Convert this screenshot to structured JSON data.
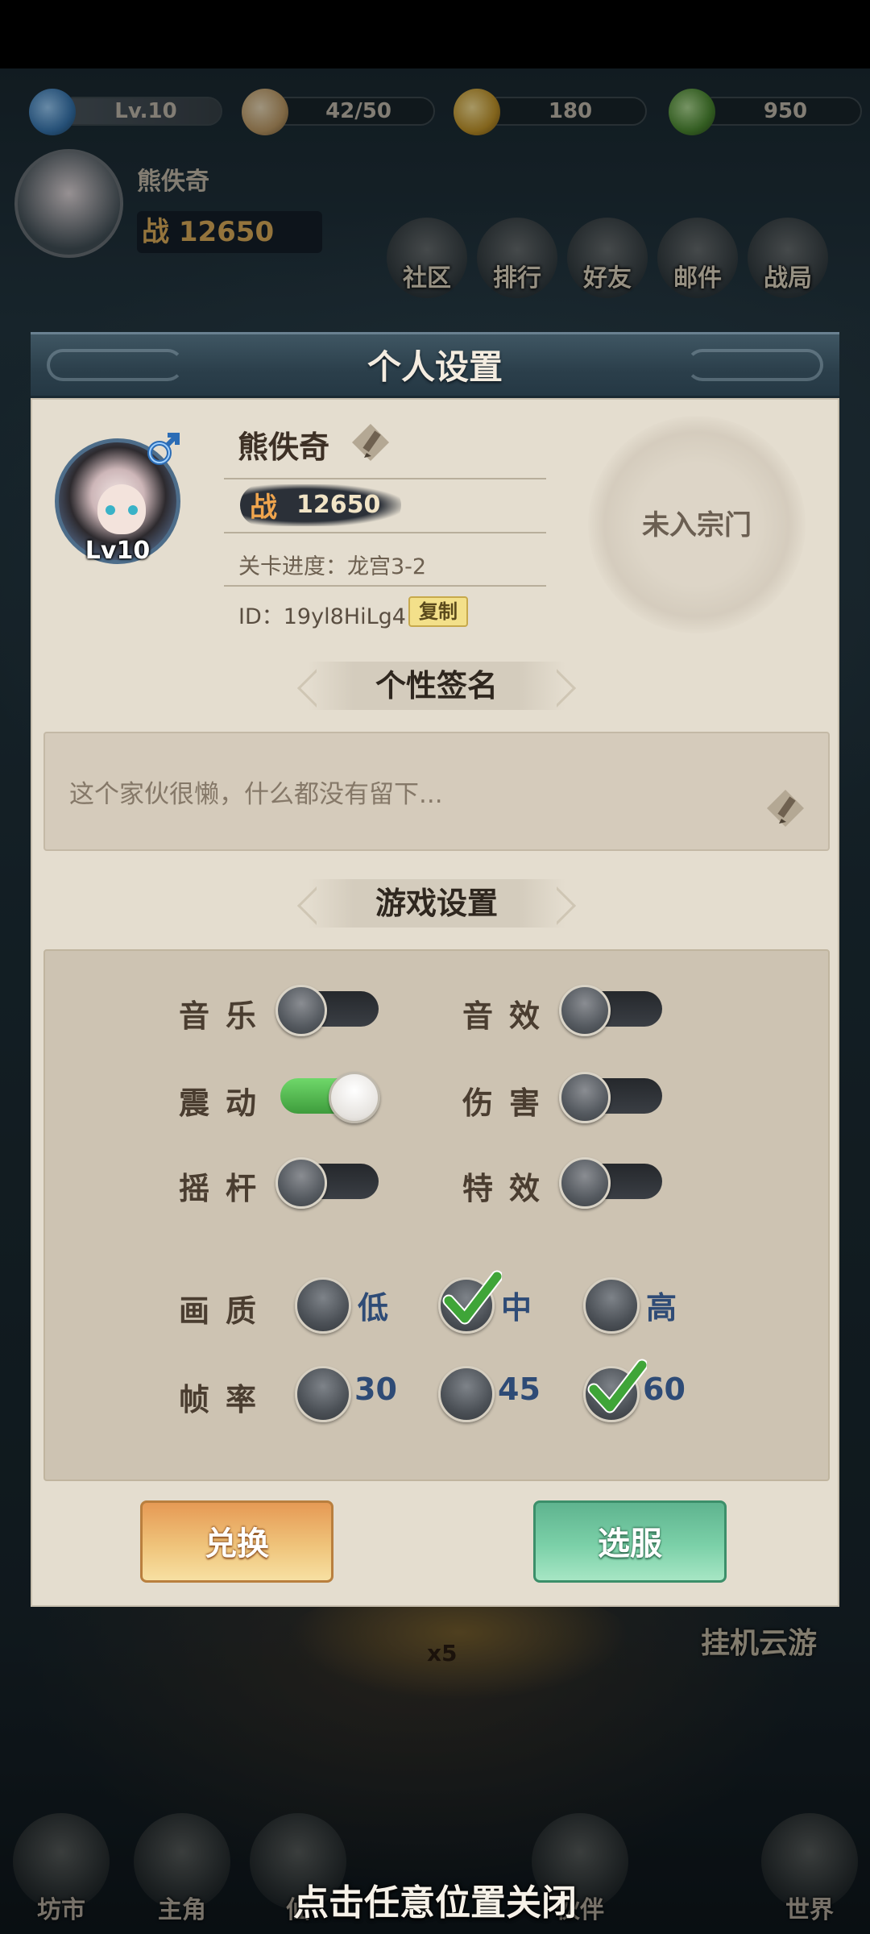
{
  "hud": {
    "level": "Lv.10",
    "stamina": "42/50",
    "coins": "180",
    "jade": "950",
    "player_name": "熊佚奇",
    "power": "战 12650",
    "menu": [
      "社区",
      "排行",
      "好友",
      "邮件",
      "战局"
    ]
  },
  "scene": {
    "cloud_tour": "挂机云游",
    "stage_count": "x5"
  },
  "bottom_nav": [
    "坊市",
    "主角",
    "仙",
    "伙伴",
    "世界"
  ],
  "dialog": {
    "title": "个人设置",
    "profile": {
      "name": "熊佚奇",
      "avatar_level": "Lv10",
      "power_prefix": "战",
      "power": "12650",
      "stage_progress": "关卡进度：龙宫3-2",
      "id": "ID：19yl8HiLg4",
      "copy_label": "复制",
      "sect": "未入宗门"
    },
    "signature": {
      "title": "个性签名",
      "text": "这个家伙很懒，什么都没有留下..."
    },
    "game_settings": {
      "title": "游戏设置",
      "toggles": [
        {
          "label": "音乐",
          "on": false
        },
        {
          "label": "音效",
          "on": false
        },
        {
          "label": "震动",
          "on": true
        },
        {
          "label": "伤害",
          "on": false
        },
        {
          "label": "摇杆",
          "on": false
        },
        {
          "label": "特效",
          "on": false
        }
      ],
      "quality": {
        "label": "画质",
        "options": [
          "低",
          "中",
          "高"
        ],
        "selected": "中"
      },
      "framerate": {
        "label": "帧率",
        "options": [
          "30",
          "45",
          "60"
        ],
        "selected": "60"
      }
    },
    "buttons": {
      "exchange": "兑换",
      "server": "选服"
    }
  },
  "close_hint": "点击任意位置关闭",
  "colors": {
    "toggle_on": "#4eb84a",
    "check": "#3fa538",
    "header": "#2e4450",
    "panel": "#e4ddcf"
  }
}
